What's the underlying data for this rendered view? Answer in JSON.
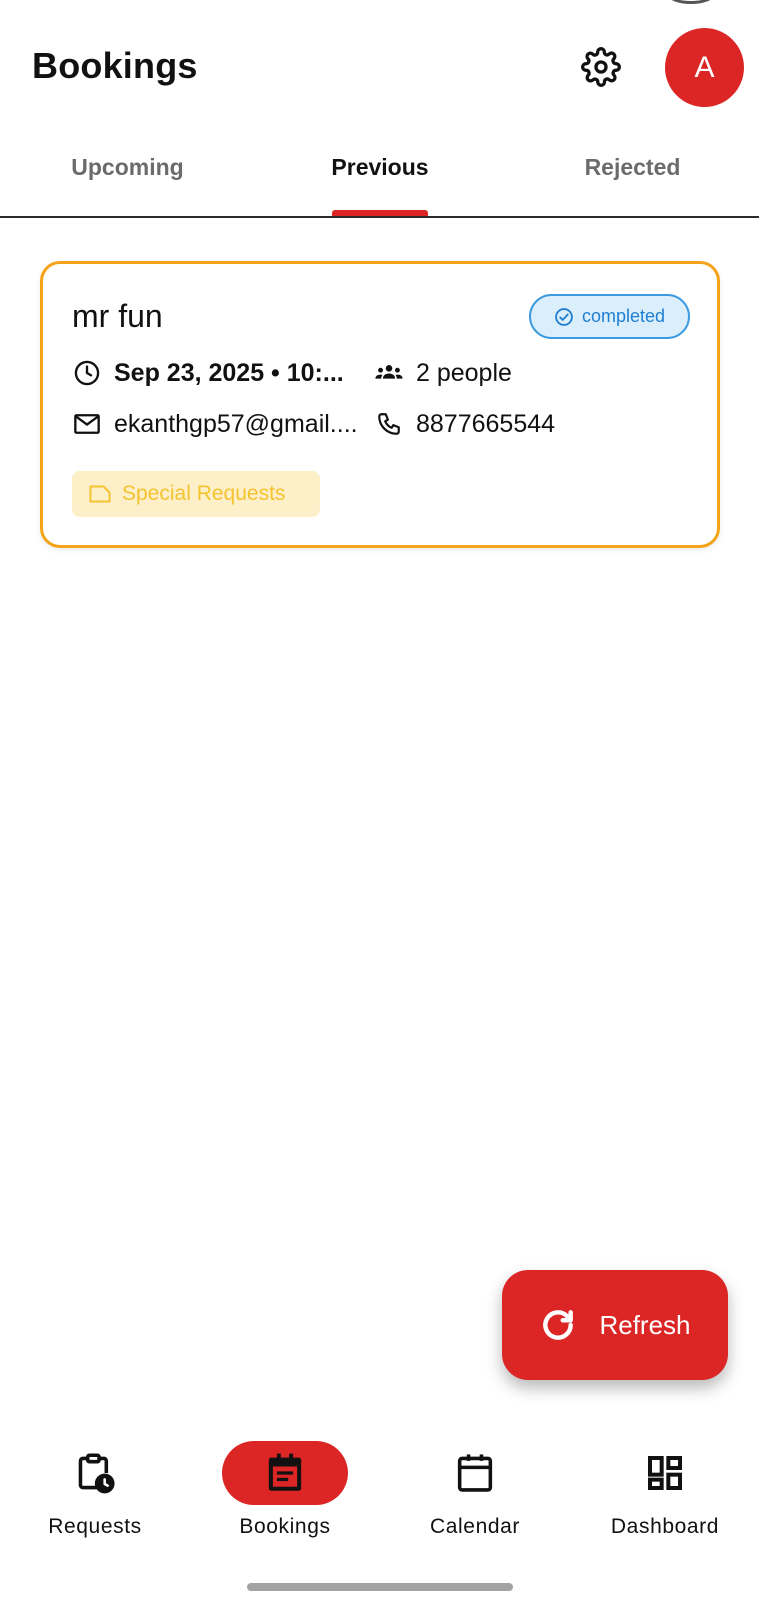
{
  "header": {
    "title": "Bookings",
    "settings_icon": "gear-icon",
    "avatar_initial": "A"
  },
  "tabs": [
    {
      "label": "Upcoming",
      "active": false
    },
    {
      "label": "Previous",
      "active": true
    },
    {
      "label": "Rejected",
      "active": false
    }
  ],
  "bookings": [
    {
      "name": "mr fun",
      "status": "completed",
      "datetime": "Sep 23, 2025 • 10:...",
      "people": "2 people",
      "email": "ekanthgp57@gmail....",
      "phone": "8877665544",
      "special_requests_label": "Special Requests"
    }
  ],
  "fab": {
    "label": "Refresh",
    "icon": "refresh-icon"
  },
  "bottom_nav": [
    {
      "label": "Requests",
      "icon": "clipboard-clock-icon",
      "active": false
    },
    {
      "label": "Bookings",
      "icon": "event-note-icon",
      "active": true
    },
    {
      "label": "Calendar",
      "icon": "calendar-icon",
      "active": false
    },
    {
      "label": "Dashboard",
      "icon": "dashboard-icon",
      "active": false
    }
  ],
  "colors": {
    "accent": "#dc2626",
    "card_border": "#f5a31a",
    "status_blue": "#1f7fd1",
    "special_chip_bg": "#fdefc7",
    "special_chip_text": "#f4c430"
  }
}
